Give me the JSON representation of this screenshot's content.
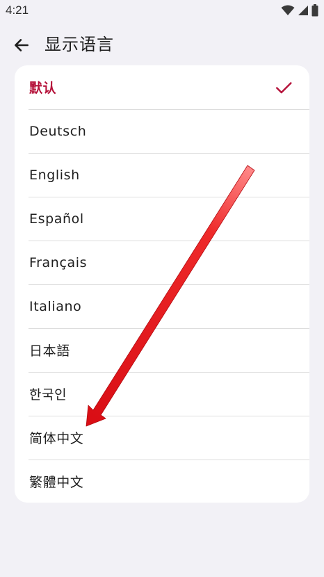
{
  "status_bar": {
    "time": "4:21",
    "icons": [
      "wifi-icon",
      "cellular-signal-icon",
      "battery-icon"
    ]
  },
  "app_bar": {
    "back_icon": "arrow-left-icon",
    "title": "显示语言"
  },
  "languages": {
    "selected_index": 0,
    "items": [
      {
        "label": "默认"
      },
      {
        "label": "Deutsch"
      },
      {
        "label": "English"
      },
      {
        "label": "Español"
      },
      {
        "label": "Français"
      },
      {
        "label": "Italiano"
      },
      {
        "label": "日本語"
      },
      {
        "label": "한국인"
      },
      {
        "label": "简体中文"
      },
      {
        "label": "繁體中文"
      }
    ]
  },
  "colors": {
    "accent": "#b5123a",
    "background": "#f2f1f6",
    "card": "#ffffff",
    "annotation_arrow": "#e8141b"
  }
}
